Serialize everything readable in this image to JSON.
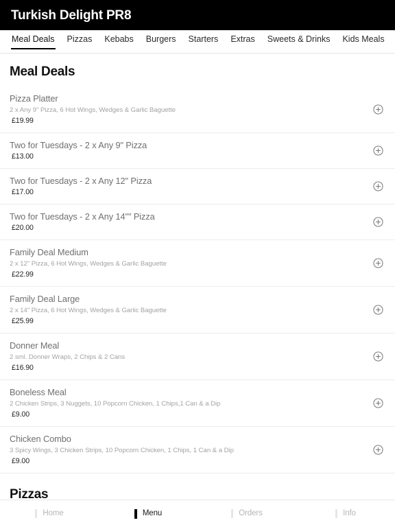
{
  "header": {
    "title": "Turkish Delight PR8"
  },
  "tabs": [
    {
      "label": "Meal Deals",
      "active": true
    },
    {
      "label": "Pizzas",
      "active": false
    },
    {
      "label": "Kebabs",
      "active": false
    },
    {
      "label": "Burgers",
      "active": false
    },
    {
      "label": "Starters",
      "active": false
    },
    {
      "label": "Extras",
      "active": false
    },
    {
      "label": "Sweets & Drinks",
      "active": false
    },
    {
      "label": "Kids Meals",
      "active": false
    }
  ],
  "sections": [
    {
      "heading": "Meal Deals",
      "items": [
        {
          "name": "Pizza Platter",
          "desc": "2 x Any 9\" Pizza, 6 Hot Wings, Wedges & Garlic Baguette",
          "price": "£19.99",
          "add_icon": "plus-circle-icon"
        },
        {
          "name": "Two for Tuesdays - 2 x Any 9\" Pizza",
          "desc": "",
          "price": "£13.00",
          "add_icon": "plus-circle-icon"
        },
        {
          "name": "Two for Tuesdays - 2 x Any 12\" Pizza",
          "desc": "",
          "price": "£17.00",
          "add_icon": "plus-circle-icon"
        },
        {
          "name": "Two for Tuesdays - 2 x Any 14\"\" Pizza",
          "desc": "",
          "price": "£20.00",
          "add_icon": "plus-circle-icon"
        },
        {
          "name": "Family Deal Medium",
          "desc": "2 x 12\" Pizza, 6 Hot Wings, Wedges & Garlic Baguette",
          "price": "£22.99",
          "add_icon": "plus-circle-icon"
        },
        {
          "name": "Family Deal Large",
          "desc": "2 x 14\" Pizza, 6 Hot Wings, Wedges & Garlic Baguette",
          "price": "£25.99",
          "add_icon": "plus-circle-icon"
        },
        {
          "name": "Donner Meal",
          "desc": "2 sml. Donner Wraps, 2 Chips & 2 Cans",
          "price": "£16.90",
          "add_icon": "plus-circle-icon"
        },
        {
          "name": "Boneless Meal",
          "desc": "2 Chicken Strips, 3 Nuggets, 10 Popcorn Chicken, 1 Chips,1 Can & a Dip",
          "price": "£9.00",
          "add_icon": "plus-circle-icon"
        },
        {
          "name": "Chicken Combo",
          "desc": "3 Spicy Wings, 3 Chicken Strips, 10 Popcorn Chicken, 1 Chips, 1 Can & a Dip",
          "price": "£9.00",
          "add_icon": "plus-circle-icon"
        }
      ]
    },
    {
      "heading": "Pizzas",
      "items": []
    }
  ],
  "bottom_nav": [
    {
      "label": "Home",
      "icon": "home-icon",
      "active": false
    },
    {
      "label": "Menu",
      "icon": "menu-icon",
      "active": true
    },
    {
      "label": "Orders",
      "icon": "orders-icon",
      "active": false
    },
    {
      "label": "Info",
      "icon": "info-icon",
      "active": false
    }
  ],
  "colors": {
    "header_bg": "#000000",
    "header_text": "#ffffff",
    "active_tab_underline": "#000000",
    "item_name": "#6f6f6f",
    "item_desc": "#a3a3a3",
    "item_price": "#1f1f1f",
    "divider": "#ececec",
    "nav_inactive": "#b5b5b5",
    "nav_active": "#1a1a1a"
  }
}
